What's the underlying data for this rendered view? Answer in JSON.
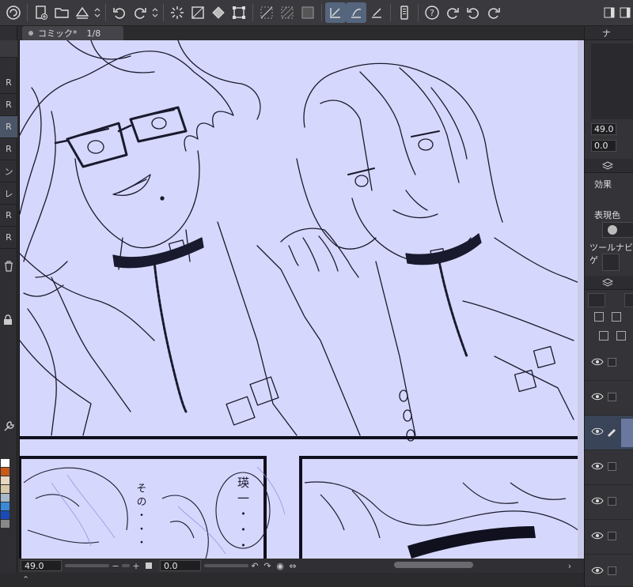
{
  "document": {
    "tab_title": "コミック*",
    "page_indicator": "1/8"
  },
  "statusbar": {
    "zoom": "49.0",
    "rotation": "0.0",
    "minus": "−",
    "plus": "+"
  },
  "navigator": {
    "zoom": "49.0",
    "rotation": "0.0"
  },
  "panel_labels": {
    "effect": "効果",
    "expression_color": "表現色",
    "tool_navigator": "ツールナビゲ"
  },
  "left_strip": [
    "R",
    "R",
    "R",
    "R",
    "ン",
    "レ",
    "R",
    "R"
  ],
  "speech": {
    "bubble1": "そ の ・ ・ ・",
    "bubble2": "瑛 一 ・ ・ ・"
  },
  "colors": {
    "canvas_bg": "#d6d7fc",
    "ink": "#1a1a2e",
    "accent": "#55657e"
  }
}
